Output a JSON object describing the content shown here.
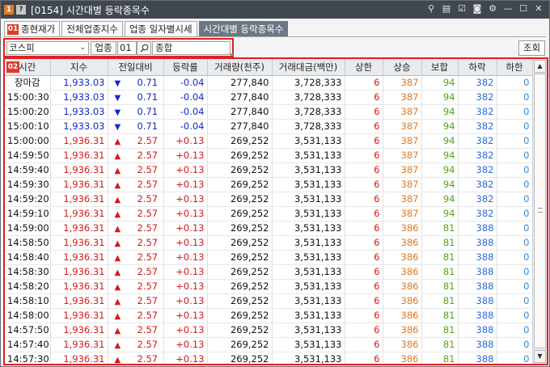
{
  "window": {
    "badge": "1",
    "help": "?",
    "title": "[0154] 시간대별 등락종목수",
    "icons": [
      "pin-icon",
      "layout-icon",
      "note-icon",
      "camera-icon",
      "settings-icon",
      "minimize-icon",
      "maximize-icon",
      "close-icon"
    ]
  },
  "tabs": [
    {
      "label": "종현재가",
      "badge": "01",
      "active": false
    },
    {
      "label": "전체업종지수",
      "active": false
    },
    {
      "label": "업종 일자별시세",
      "active": false
    },
    {
      "label": "시간대별 등락종목수",
      "active": true
    }
  ],
  "filter": {
    "market": "코스피",
    "sector_label": "업종",
    "sector_code": "01",
    "sector_name": "종합"
  },
  "query_button": "조회",
  "grid": {
    "badge": "02",
    "columns": [
      "시간",
      "지수",
      "전일대비",
      "등락률",
      "거래량(천주)",
      "거래대금(백만)",
      "상한",
      "상승",
      "보합",
      "하락",
      "하한"
    ],
    "rows": [
      {
        "time": "장마감",
        "index": "1,933.03",
        "dir": "▼",
        "change": "0.71",
        "rate": "-0.04",
        "volume": "277,840",
        "amount": "3,728,333",
        "upper": "6",
        "rise": "387",
        "flat": "94",
        "fall": "382",
        "lower": "0",
        "trend": "down"
      },
      {
        "time": "15:00:30",
        "index": "1,933.03",
        "dir": "▼",
        "change": "0.71",
        "rate": "-0.04",
        "volume": "277,840",
        "amount": "3,728,333",
        "upper": "6",
        "rise": "387",
        "flat": "94",
        "fall": "382",
        "lower": "0",
        "trend": "down"
      },
      {
        "time": "15:00:20",
        "index": "1,933.03",
        "dir": "▼",
        "change": "0.71",
        "rate": "-0.04",
        "volume": "277,840",
        "amount": "3,728,333",
        "upper": "6",
        "rise": "387",
        "flat": "94",
        "fall": "382",
        "lower": "0",
        "trend": "down"
      },
      {
        "time": "15:00:10",
        "index": "1,933.03",
        "dir": "▼",
        "change": "0.71",
        "rate": "-0.04",
        "volume": "277,840",
        "amount": "3,728,333",
        "upper": "6",
        "rise": "387",
        "flat": "94",
        "fall": "382",
        "lower": "0",
        "trend": "down"
      },
      {
        "time": "15:00:00",
        "index": "1,936.31",
        "dir": "▲",
        "change": "2.57",
        "rate": "+0.13",
        "volume": "269,252",
        "amount": "3,531,133",
        "upper": "6",
        "rise": "387",
        "flat": "94",
        "fall": "382",
        "lower": "0",
        "trend": "up"
      },
      {
        "time": "14:59:50",
        "index": "1,936.31",
        "dir": "▲",
        "change": "2.57",
        "rate": "+0.13",
        "volume": "269,252",
        "amount": "3,531,133",
        "upper": "6",
        "rise": "387",
        "flat": "94",
        "fall": "382",
        "lower": "0",
        "trend": "up"
      },
      {
        "time": "14:59:40",
        "index": "1,936.31",
        "dir": "▲",
        "change": "2.57",
        "rate": "+0.13",
        "volume": "269,252",
        "amount": "3,531,133",
        "upper": "6",
        "rise": "387",
        "flat": "94",
        "fall": "382",
        "lower": "0",
        "trend": "up"
      },
      {
        "time": "14:59:30",
        "index": "1,936.31",
        "dir": "▲",
        "change": "2.57",
        "rate": "+0.13",
        "volume": "269,252",
        "amount": "3,531,133",
        "upper": "6",
        "rise": "387",
        "flat": "94",
        "fall": "382",
        "lower": "0",
        "trend": "up"
      },
      {
        "time": "14:59:20",
        "index": "1,936.31",
        "dir": "▲",
        "change": "2.57",
        "rate": "+0.13",
        "volume": "269,252",
        "amount": "3,531,133",
        "upper": "6",
        "rise": "387",
        "flat": "94",
        "fall": "382",
        "lower": "0",
        "trend": "up"
      },
      {
        "time": "14:59:10",
        "index": "1,936.31",
        "dir": "▲",
        "change": "2.57",
        "rate": "+0.13",
        "volume": "269,252",
        "amount": "3,531,133",
        "upper": "6",
        "rise": "387",
        "flat": "94",
        "fall": "382",
        "lower": "0",
        "trend": "up"
      },
      {
        "time": "14:59:00",
        "index": "1,936.31",
        "dir": "▲",
        "change": "2.57",
        "rate": "+0.13",
        "volume": "269,252",
        "amount": "3,531,133",
        "upper": "6",
        "rise": "386",
        "flat": "81",
        "fall": "388",
        "lower": "0",
        "trend": "up"
      },
      {
        "time": "14:58:50",
        "index": "1,936.31",
        "dir": "▲",
        "change": "2.57",
        "rate": "+0.13",
        "volume": "269,252",
        "amount": "3,531,133",
        "upper": "6",
        "rise": "386",
        "flat": "81",
        "fall": "388",
        "lower": "0",
        "trend": "up"
      },
      {
        "time": "14:58:40",
        "index": "1,936.31",
        "dir": "▲",
        "change": "2.57",
        "rate": "+0.13",
        "volume": "269,252",
        "amount": "3,531,133",
        "upper": "6",
        "rise": "386",
        "flat": "81",
        "fall": "388",
        "lower": "0",
        "trend": "up"
      },
      {
        "time": "14:58:30",
        "index": "1,936.31",
        "dir": "▲",
        "change": "2.57",
        "rate": "+0.13",
        "volume": "269,252",
        "amount": "3,531,133",
        "upper": "6",
        "rise": "386",
        "flat": "81",
        "fall": "388",
        "lower": "0",
        "trend": "up"
      },
      {
        "time": "14:58:20",
        "index": "1,936.31",
        "dir": "▲",
        "change": "2.57",
        "rate": "+0.13",
        "volume": "269,252",
        "amount": "3,531,133",
        "upper": "6",
        "rise": "386",
        "flat": "81",
        "fall": "388",
        "lower": "0",
        "trend": "up"
      },
      {
        "time": "14:58:10",
        "index": "1,936.31",
        "dir": "▲",
        "change": "2.57",
        "rate": "+0.13",
        "volume": "269,252",
        "amount": "3,531,133",
        "upper": "6",
        "rise": "386",
        "flat": "81",
        "fall": "388",
        "lower": "0",
        "trend": "up"
      },
      {
        "time": "14:58:00",
        "index": "1,936.31",
        "dir": "▲",
        "change": "2.57",
        "rate": "+0.13",
        "volume": "269,252",
        "amount": "3,531,133",
        "upper": "6",
        "rise": "386",
        "flat": "81",
        "fall": "388",
        "lower": "0",
        "trend": "up"
      },
      {
        "time": "14:57:50",
        "index": "1,936.31",
        "dir": "▲",
        "change": "2.57",
        "rate": "+0.13",
        "volume": "269,252",
        "amount": "3,531,133",
        "upper": "6",
        "rise": "386",
        "flat": "81",
        "fall": "388",
        "lower": "0",
        "trend": "up"
      },
      {
        "time": "14:57:40",
        "index": "1,936.31",
        "dir": "▲",
        "change": "2.57",
        "rate": "+0.13",
        "volume": "269,252",
        "amount": "3,531,133",
        "upper": "6",
        "rise": "386",
        "flat": "81",
        "fall": "388",
        "lower": "0",
        "trend": "up"
      },
      {
        "time": "14:57:30",
        "index": "1,936.31",
        "dir": "▲",
        "change": "2.57",
        "rate": "+0.13",
        "volume": "269,252",
        "amount": "3,531,133",
        "upper": "6",
        "rise": "386",
        "flat": "81",
        "fall": "388",
        "lower": "0",
        "trend": "up"
      }
    ]
  },
  "colors": {
    "up": "#d81818",
    "down": "#1528c8",
    "rise": "#e07820",
    "flat": "#58a018",
    "fall": "#2a6cd8",
    "highlight_border": "#e02020",
    "titlebar": "#3f4750"
  }
}
